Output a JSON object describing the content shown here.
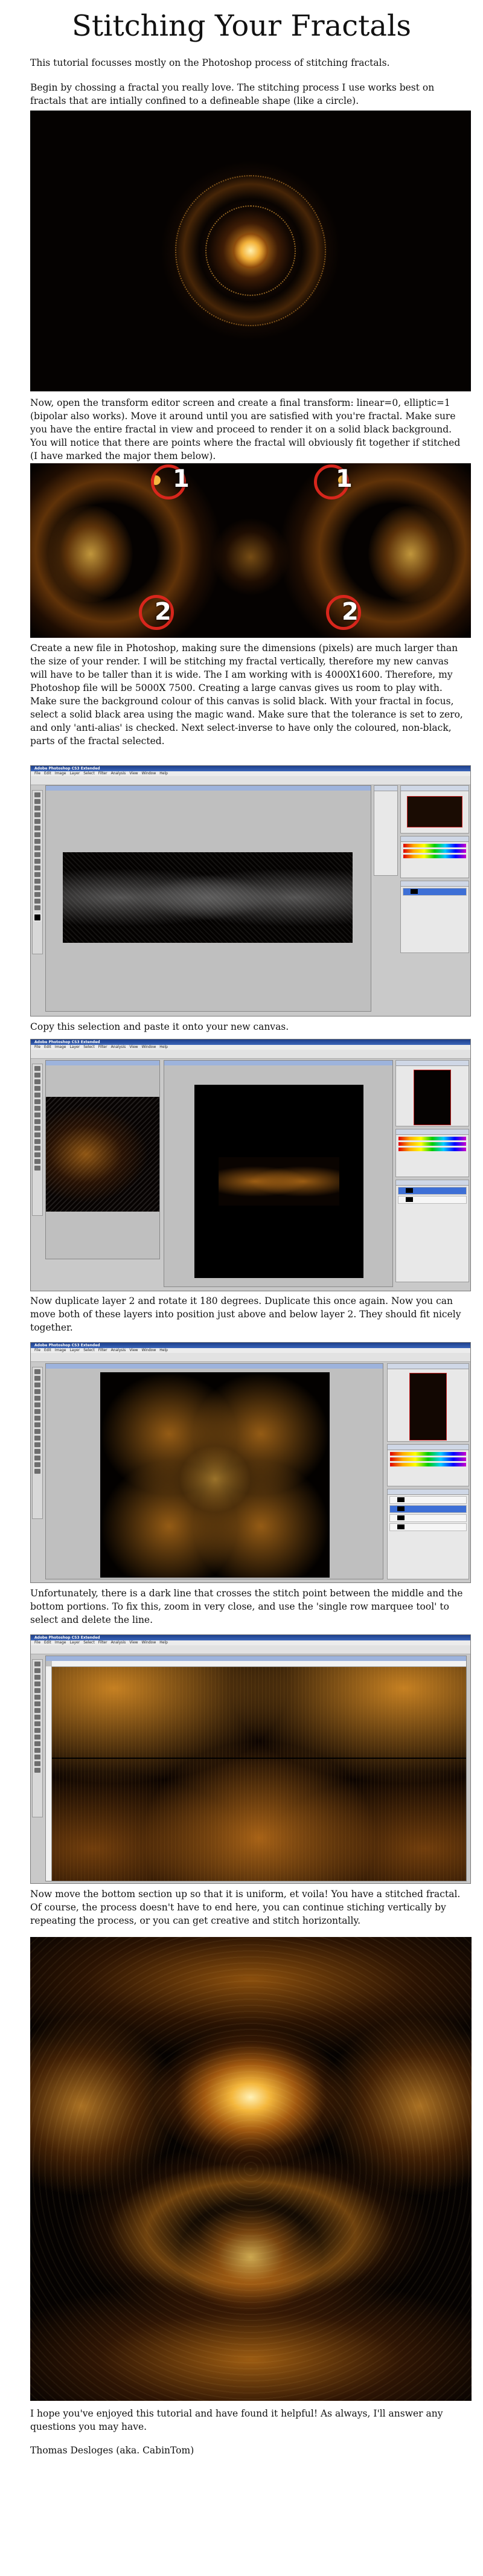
{
  "title": "Stitching Your Fractals",
  "paragraphs": {
    "p1": "This tutorial focusses mostly on the Photoshop process of stitching fractals.",
    "p2": "Begin by chossing a fractal you really love. The stitching process I use works best on fractals that are intially confined to a defineable shape (like a circle).",
    "p3": "Now, open the transform editor screen and create a final transform: linear=0, elliptic=1 (bipolar also works). Move it around until you are satisfied with you're fractal. Make sure you have the entire fractal in view and proceed to render it on a solid black background. You will notice that there are points where the fractal will obviously fit together if stitched (I have marked the major them below).",
    "p4": "Create a new file in Photoshop, making sure the dimensions (pixels) are much larger than the size of your render. I will be stitching my fractal vertically, therefore my new canvas will have to be taller than it is wide. The I am working with is 4000X1600. Therefore, my Photoshop file will be 5000X 7500. Creating a large canvas gives us room to play with. Make sure the background colour of this canvas is solid black. With your fractal in focus, select a solid black area using the magic wand. Make sure that the tolerance is set to zero, and only 'anti-alias' is checked. Next select-inverse to have only the coloured, non-black, parts of the fractal selected.",
    "p5": "Copy this selection and paste it onto your new canvas.",
    "p6": "Now duplicate layer 2 and rotate it 180 degrees. Duplicate this once again. Now you can move both of these layers into position just above and below layer 2. They should fit nicely together.",
    "p7": "Unfortunately, there is a dark line that crosses the stitch point between the middle and the bottom portions. To fix this, zoom in very close, and use the 'single row marquee tool' to select and delete the line.",
    "p8": "Now move the bottom section up so that it is uniform, et voila! You have a stitched fractal. Of course, the process doesn't have to end here, you can continue stiching vertically by repeating the process, or you can get creative and stitch horizontally.",
    "p9": "I hope you've enjoyed this tutorial and have found it helpful! As always, I'll answer any questions you may have.",
    "signature": "Thomas Desloges (aka. CabinTom)"
  },
  "markers": {
    "m1": "1",
    "m2": "1",
    "m3": "2",
    "m4": "2"
  },
  "photoshop": {
    "app_title": "Adobe Photoshop CS3 Extended",
    "menu": [
      "File",
      "Edit",
      "Image",
      "Layer",
      "Select",
      "Filter",
      "Analysis",
      "View",
      "Window",
      "Help"
    ],
    "workspace_label": "Workspace"
  },
  "colors": {
    "fractal_bg": "#050201",
    "fractal_gold": "#e39a1f",
    "marker_red": "#d8261c"
  }
}
